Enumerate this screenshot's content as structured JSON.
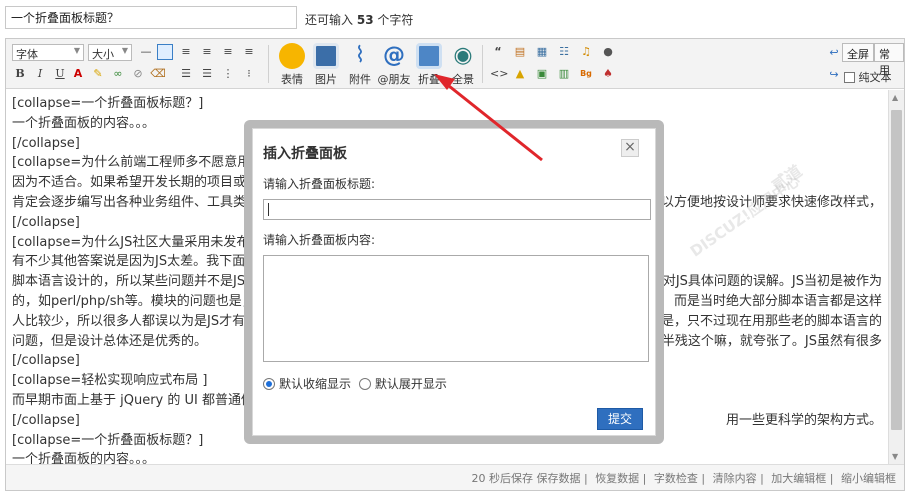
{
  "title_field": {
    "value": "一个折叠面板标题？"
  },
  "char_count": {
    "prefix": "还可输入",
    "count": "53",
    "suffix": "个字符"
  },
  "toolbar": {
    "font_select": "字体",
    "size_select": "大小",
    "bold": "B",
    "italic": "I",
    "underline": "U",
    "buttons": {
      "emoji": "表情",
      "image": "图片",
      "attach": "附件",
      "at": "@朋友",
      "collapse": "折叠",
      "preview": "全景"
    },
    "fullscreen": "全屏",
    "common": "常用",
    "plaintext": "纯文本"
  },
  "content_lines": [
    "[collapse=一个折叠面板标题？]",
    "一个折叠面板的内容。。。",
    "[/collapse]",
    "[collapse=为什么前端工程师多不愿意用 B",
    "因为不适合。如果希望开发长期的项目或",
    "肯定会逐步编写出各种业务组件、工具类",
    "[/collapse]",
    "[collapse=为什么JS社区大量采用未发布或",
    "有不少其他答案说是因为JS太差。我下面",
    "脚本语言设计的，所以某些问题并不是JS",
    "的，如perl/php/sh等。模块的问题也是，",
    "人比较少，所以很多人都误以为是JS才有",
    "问题，但是设计总体还是优秀的。",
    "[/collapse]",
    "[collapse=轻松实现响应式布局 ]",
    "而早期市面上基于 jQuery 的 UI 都普通做",
    "[/collapse]",
    "[collapse=一个折叠面板标题？]",
    "一个折叠面板的内容。。。"
  ],
  "content_right": [
    {
      "line": 5,
      "text": "以方便地按设计师要求快速修改样式，"
    },
    {
      "line": 9,
      "text": "对JS具体问题的误解。JS当初是被作为"
    },
    {
      "line": 10,
      "text": "而是当时绝大部分脚本语言都是这样"
    },
    {
      "line": 11,
      "text": "是，只不过现在用那些老的脚本语言的"
    },
    {
      "line": 12,
      "text": "半残这个嘛，就夸张了。JS虽然有很多"
    },
    {
      "line": 16,
      "text": "用一些更科学的架构方式。"
    }
  ],
  "statusbar": {
    "autosave": "20 秒后保存 保存数据",
    "restore": "恢复数据",
    "word_check": "字数检查",
    "clear": "清除内容",
    "enlarge": "加大编辑框",
    "shrink": "缩小编辑框"
  },
  "watermark": {
    "brand": "DISCUZ!应用中心",
    "site": "addon.dismall.com",
    "extra": "贰道"
  },
  "dialog": {
    "title": "插入折叠面板",
    "close": "×",
    "title_label": "请输入折叠面板标题:",
    "title_value": "",
    "content_label": "请输入折叠面板内容:",
    "content_value": "",
    "radio_collapsed": "默认收缩显示",
    "radio_expanded": "默认展开显示",
    "radio_selected": "collapsed",
    "submit": "提交"
  },
  "colors": {
    "accent": "#2f6fbf",
    "arrow": "#e0262b",
    "dialog_frame": "#b9b9b9"
  }
}
